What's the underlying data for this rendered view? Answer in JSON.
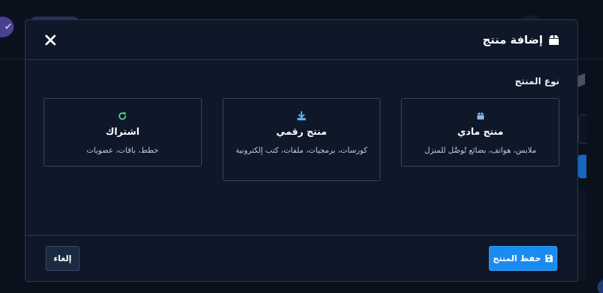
{
  "modal": {
    "title": "إضافة منتج",
    "title_icon": "box-icon",
    "close_icon": "close-icon",
    "section_label": "نوع المنتج",
    "options": [
      {
        "title": "منتج مادي",
        "description": "ملابس، هواتف، بضائع تُوصَّل للمنزل",
        "icon": "box-icon",
        "icon_color": "#8ab8ee"
      },
      {
        "title": "منتج رقمي",
        "description": "كورسات، برمجيات، ملفات، كتب إلكترونية",
        "icon": "download-icon",
        "icon_color": "#5ab3f0"
      },
      {
        "title": "اشتراك",
        "description": "خطط، باقات، عضويات",
        "icon": "refresh-icon",
        "icon_color": "#4fd18b"
      }
    ],
    "footer": {
      "save_label": "حفظ المنتج",
      "save_icon": "save-icon",
      "cancel_label": "إلغاء"
    }
  },
  "colors": {
    "primary": "#1a8cf0",
    "modal_bg": "#0f1829",
    "border": "#2a3a55"
  }
}
